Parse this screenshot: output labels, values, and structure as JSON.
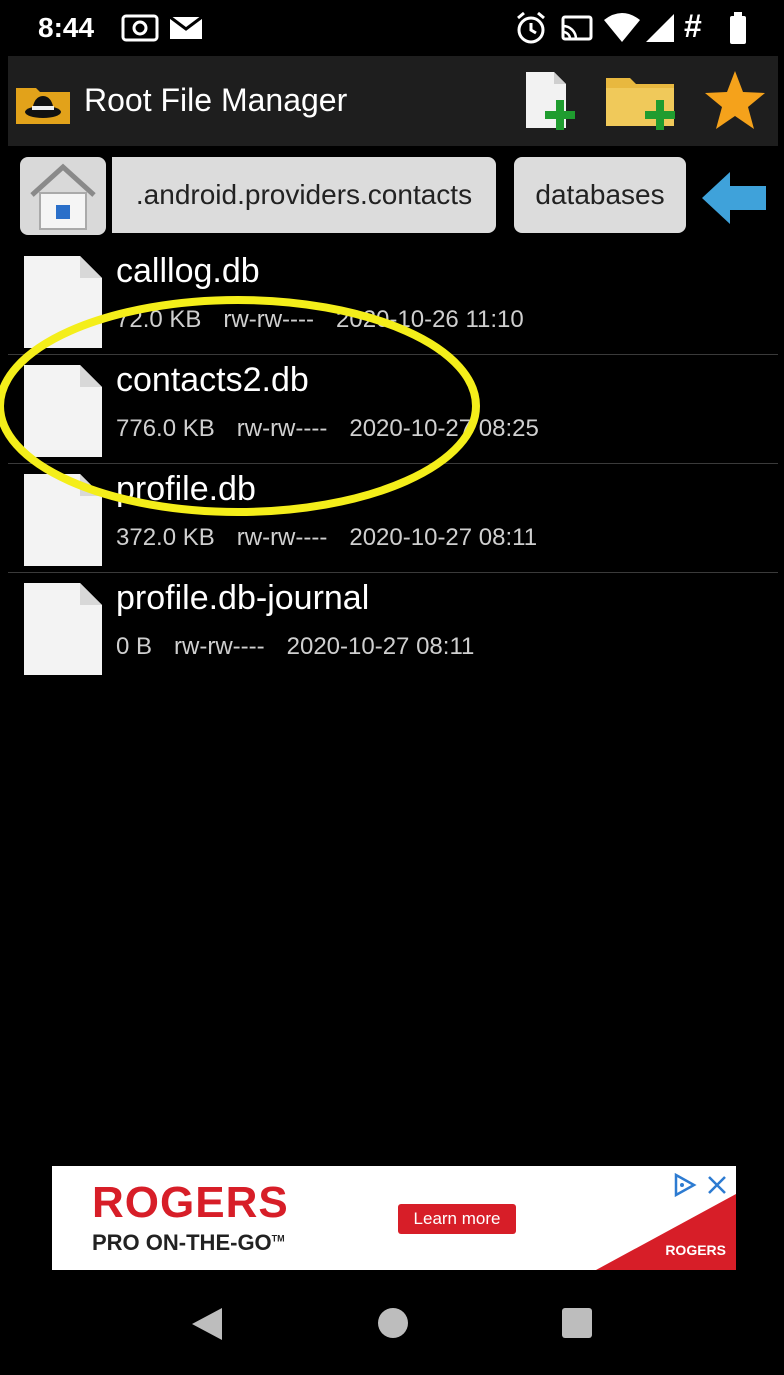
{
  "status_bar": {
    "time": "8:44"
  },
  "app_bar": {
    "title": "Root File Manager",
    "icons": [
      "hat-app-icon",
      "new-file-icon",
      "new-folder-icon",
      "star-icon"
    ]
  },
  "breadcrumb": {
    "segments": [
      ".android.providers.contacts",
      "databases"
    ]
  },
  "files": [
    {
      "name": "calllog.db",
      "size": "72.0 KB",
      "perms": "rw-rw----",
      "date": "2020-10-26 11:10"
    },
    {
      "name": "contacts2.db",
      "size": "776.0 KB",
      "perms": "rw-rw----",
      "date": "2020-10-27 08:25"
    },
    {
      "name": "profile.db",
      "size": "372.0 KB",
      "perms": "rw-rw----",
      "date": "2020-10-27 08:11"
    },
    {
      "name": "profile.db-journal",
      "size": "0 B",
      "perms": "rw-rw----",
      "date": "2020-10-27 08:11"
    }
  ],
  "ad": {
    "brand": "ROGERS",
    "tagline": "PRO ON-THE-GO",
    "trademark": "TM",
    "cta": "Learn more",
    "logo_text": "ROGERS",
    "brand_color": "#d71e28"
  },
  "colors": {
    "highlight": "#f4ee1a",
    "app_bar": "#1e1e1e"
  }
}
